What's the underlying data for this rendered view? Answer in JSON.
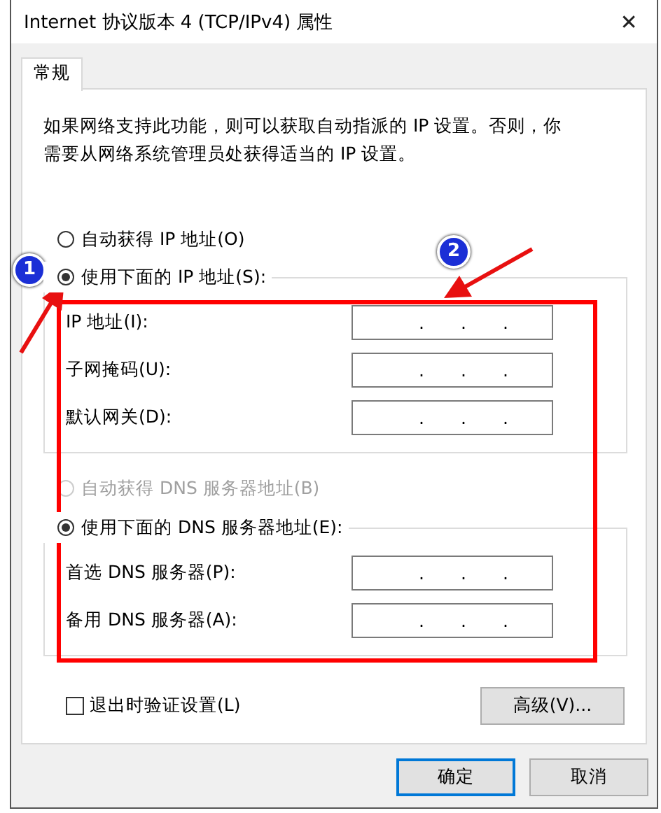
{
  "window": {
    "title": "Internet 协议版本 4 (TCP/IPv4) 属性",
    "close": "✕"
  },
  "tabs": [
    {
      "label": "常规",
      "selected": true
    }
  ],
  "description": "如果网络支持此功能，则可以获取自动指派的 IP 设置。否则，你需要从网络系统管理员处获得适当的 IP 设置。",
  "ip_mode": [
    {
      "label": "自动获得 IP 地址(O)",
      "selected": false,
      "disabled": false
    },
    {
      "label": "使用下面的 IP 地址(S):",
      "selected": true,
      "disabled": false
    }
  ],
  "ip_fields": [
    {
      "label": "IP 地址(I):",
      "separators": [
        ".",
        ".",
        "."
      ]
    },
    {
      "label": "子网掩码(U):",
      "separators": [
        ".",
        ".",
        "."
      ]
    },
    {
      "label": "默认网关(D):",
      "separators": [
        ".",
        ".",
        "."
      ]
    }
  ],
  "dns_mode": [
    {
      "label": "自动获得 DNS 服务器地址(B)",
      "selected": false,
      "disabled": true
    },
    {
      "label": "使用下面的 DNS 服务器地址(E):",
      "selected": true,
      "disabled": false
    }
  ],
  "dns_fields": [
    {
      "label": "首选 DNS 服务器(P):",
      "separators": [
        ".",
        ".",
        "."
      ]
    },
    {
      "label": "备用 DNS 服务器(A):",
      "separators": [
        ".",
        ".",
        "."
      ]
    }
  ],
  "validate": {
    "label": "退出时验证设置(L)",
    "checked": false
  },
  "advanced_button": "高级(V)...",
  "buttons": [
    {
      "label": "确定",
      "default": true
    },
    {
      "label": "取消",
      "default": false
    }
  ],
  "annotations": [
    {
      "label": "1"
    },
    {
      "label": "2"
    }
  ]
}
